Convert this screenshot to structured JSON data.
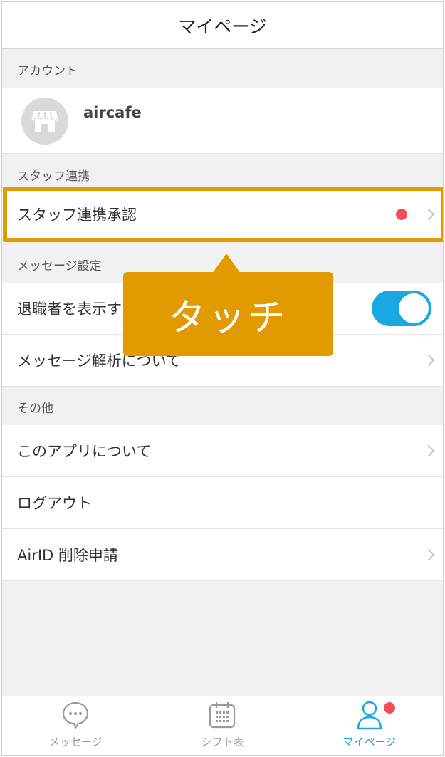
{
  "header": {
    "title": "マイページ"
  },
  "sections": {
    "account": "アカウント",
    "staff": "スタッフ連携",
    "message": "メッセージ設定",
    "other": "その他"
  },
  "account": {
    "name": "aircafe",
    "icon": "store-icon"
  },
  "rows": {
    "staff_approval": "スタッフ連携承認",
    "show_retired": "退職者を表示す",
    "message_analysis": "メッセージ解析について",
    "about_app": "このアプリについて",
    "logout": "ログアウト",
    "airid_delete": "AirID 削除申請"
  },
  "show_retired_toggle": {
    "on": true
  },
  "callout": {
    "text": "タッチ"
  },
  "tabbar": {
    "items": [
      {
        "label": "メッセージ",
        "icon": "chat-bubble-icon",
        "active": false
      },
      {
        "label": "シフト表",
        "icon": "calendar-icon",
        "active": false
      },
      {
        "label": "マイページ",
        "icon": "person-icon",
        "active": true
      }
    ]
  },
  "colors": {
    "accent": "#1ba7e2",
    "highlight": "#e19b00",
    "badge": "#ee5058",
    "background": "#f1f1f1"
  }
}
